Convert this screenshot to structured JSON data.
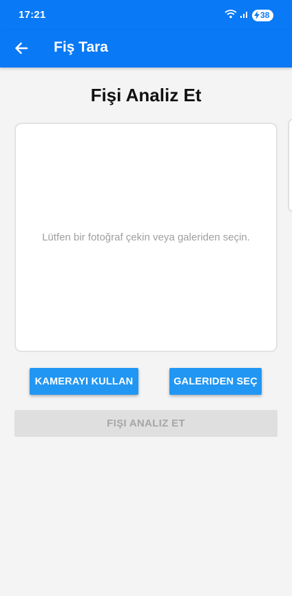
{
  "status_bar": {
    "time": "17:21",
    "battery_level": "38",
    "icons": [
      "wifi-icon",
      "signal-icon",
      "charging-bolt-icon",
      "battery-icon"
    ]
  },
  "app_bar": {
    "back_icon": "arrow-left-icon",
    "title": "Fiş Tara"
  },
  "main": {
    "title": "Fişi Analiz Et",
    "image_placeholder": "Lütfen bir fotoğraf çekin veya galeriden seçin.",
    "camera_button": "KAMERAYI KULLAN",
    "gallery_button": "GALERIDEN SEÇ",
    "analyze_button": "FIŞI ANALIZ ET",
    "analyze_enabled": false
  },
  "colors": {
    "primary": "#0a79f5",
    "button": "#2196f3",
    "disabled_bg": "#dfdfdf",
    "disabled_text": "#a6a6a6",
    "background": "#f4f4f4"
  }
}
